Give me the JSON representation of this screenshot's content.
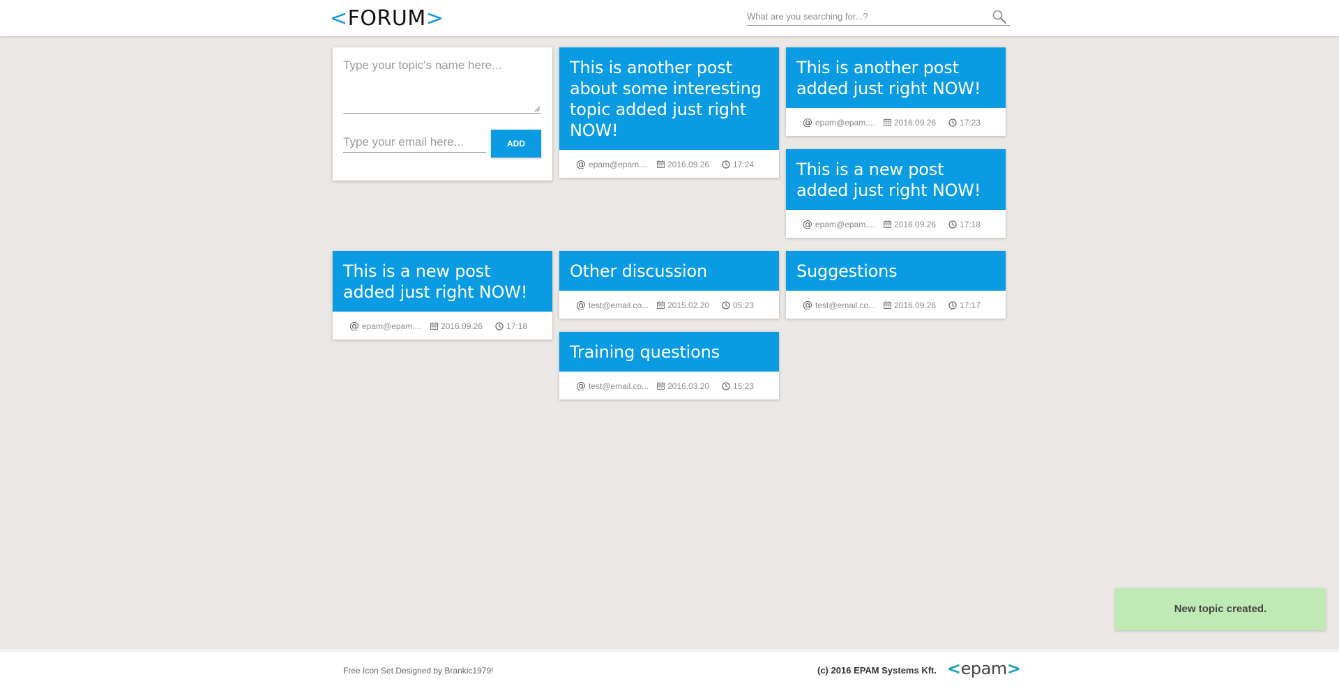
{
  "header": {
    "logo": {
      "open": "<",
      "text": "FORUM",
      "close": ">"
    },
    "search_placeholder": "What are you searching for...?"
  },
  "new_topic_form": {
    "topic_placeholder": "Type your topic's name here...",
    "email_placeholder": "Type your email here...",
    "add_label": "ADD"
  },
  "posts": [
    {
      "title": "This is another post about some interesting topic added just right NOW!",
      "email": "epam@epam....",
      "date": "2016.09.26",
      "time": "17:24"
    },
    {
      "title": "This is another post added just right NOW!",
      "email": "epam@epam....",
      "date": "2016.09.26",
      "time": "17:23"
    },
    {
      "title": "This is a new post added just right NOW!",
      "email": "epam@epam....",
      "date": "2016.09.26",
      "time": "17:18"
    },
    {
      "title": "This is a new post added just right NOW!",
      "email": "epam@epam....",
      "date": "2016.09.26",
      "time": "17:18"
    },
    {
      "title": "Other discussion",
      "email": "test@email.co...",
      "date": "2015.02.20",
      "time": "05:23"
    },
    {
      "title": "Suggestions",
      "email": "test@email.co...",
      "date": "2016.09.26",
      "time": "17:17"
    },
    {
      "title": "Training questions",
      "email": "test@email.co...",
      "date": "2016.03.20",
      "time": "15:23"
    }
  ],
  "meta_symbols": {
    "at": "@"
  },
  "toast": {
    "message": "New topic created."
  },
  "footer": {
    "credit": "Free Icon Set Designed by Brankic1979!",
    "copyright": "(c) 2016 EPAM Systems Kft.",
    "logo": {
      "open": "<",
      "text": "epam",
      "close": ">"
    }
  },
  "colors": {
    "accent": "#0a9be3",
    "page_bg": "#ebe7e4",
    "toast_bg": "#bfeab3"
  }
}
